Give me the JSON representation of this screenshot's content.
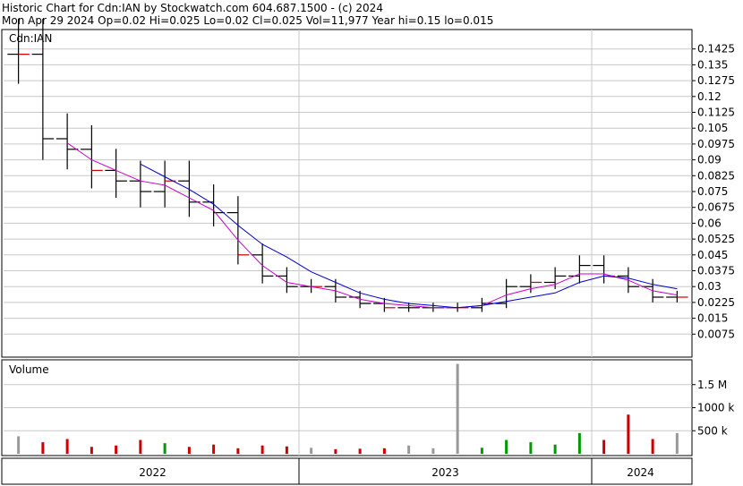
{
  "header": {
    "line1": "Historic Chart for Cdn:IAN by Stockwatch.com 604.687.1500 - (c) 2024",
    "line2": "Mon Apr 29 2024  Op=0.02  Hi=0.025  Lo=0.02  Cl=0.025  Vol=11,977  Year hi=0.15  lo=0.015"
  },
  "colors": {
    "price_bar": "#000000",
    "price_bar_highlight": "#cc0000",
    "ma_short": "#cc00cc",
    "ma_long": "#0000cc",
    "volume_up": "#009900",
    "volume_down": "#cc0000",
    "volume_flat": "#999999",
    "grid": "#c8c8c8"
  },
  "chart_data": [
    {
      "type": "line",
      "panel": "price",
      "label": "Cdn:IAN",
      "ylim": [
        0.0,
        0.15
      ],
      "y_ticks": [
        "0.1425",
        "0.135",
        "0.1275",
        "0.12",
        "0.1125",
        "0.105",
        "0.0975",
        "0.09",
        "0.0825",
        "0.075",
        "0.0675",
        "0.06",
        "0.0525",
        "0.045",
        "0.0375",
        "0.03",
        "0.0225",
        "0.015",
        "0.0075"
      ],
      "x": [
        "2022-01",
        "2022-02",
        "2022-03",
        "2022-04",
        "2022-05",
        "2022-06",
        "2022-07",
        "2022-08",
        "2022-09",
        "2022-10",
        "2022-11",
        "2022-12",
        "2023-01",
        "2023-02",
        "2023-03",
        "2023-04",
        "2023-05",
        "2023-06",
        "2023-07",
        "2023-08",
        "2023-09",
        "2023-10",
        "2023-11",
        "2023-12",
        "2024-01",
        "2024-02",
        "2024-03",
        "2024-04"
      ],
      "series": [
        {
          "role": "price",
          "values": [
            0.14,
            0.1,
            0.095,
            0.085,
            0.08,
            0.075,
            0.08,
            0.07,
            0.065,
            0.045,
            0.035,
            0.03,
            0.03,
            0.025,
            0.022,
            0.02,
            0.02,
            0.02,
            0.02,
            0.022,
            0.03,
            0.032,
            0.035,
            0.04,
            0.035,
            0.03,
            0.025,
            0.025
          ]
        },
        {
          "role": "ma_short",
          "values": [
            null,
            null,
            0.098,
            0.09,
            0.085,
            0.08,
            0.078,
            0.072,
            0.066,
            0.052,
            0.04,
            0.032,
            0.03,
            0.028,
            0.024,
            0.022,
            0.021,
            0.02,
            0.02,
            0.021,
            0.026,
            0.029,
            0.031,
            0.036,
            0.036,
            0.033,
            0.028,
            0.026
          ]
        },
        {
          "role": "ma_long",
          "values": [
            null,
            null,
            null,
            null,
            null,
            0.088,
            0.082,
            0.076,
            0.069,
            0.059,
            0.05,
            0.044,
            0.037,
            0.032,
            0.027,
            0.024,
            0.022,
            0.021,
            0.02,
            0.021,
            0.023,
            0.025,
            0.027,
            0.032,
            0.035,
            0.034,
            0.031,
            0.029
          ]
        }
      ]
    },
    {
      "type": "bar",
      "panel": "volume",
      "label": "Volume",
      "ylim": [
        0,
        2000000
      ],
      "y_ticks": [
        "1.5 M",
        "1000 k",
        "500 k"
      ],
      "x_labels": [
        "2022",
        "2023",
        "2024"
      ],
      "x": [
        "2022-01",
        "2022-02",
        "2022-03",
        "2022-04",
        "2022-05",
        "2022-06",
        "2022-07",
        "2022-08",
        "2022-09",
        "2022-10",
        "2022-11",
        "2022-12",
        "2023-01",
        "2023-02",
        "2023-03",
        "2023-04",
        "2023-05",
        "2023-06",
        "2023-07",
        "2023-08",
        "2023-09",
        "2023-10",
        "2023-11",
        "2023-12",
        "2024-01",
        "2024-02",
        "2024-03",
        "2024-04"
      ],
      "values": [
        380000,
        250000,
        320000,
        150000,
        180000,
        300000,
        230000,
        150000,
        200000,
        120000,
        180000,
        160000,
        130000,
        100000,
        110000,
        120000,
        180000,
        120000,
        1950000,
        130000,
        300000,
        250000,
        200000,
        450000,
        300000,
        850000,
        320000,
        450000
      ]
    }
  ]
}
